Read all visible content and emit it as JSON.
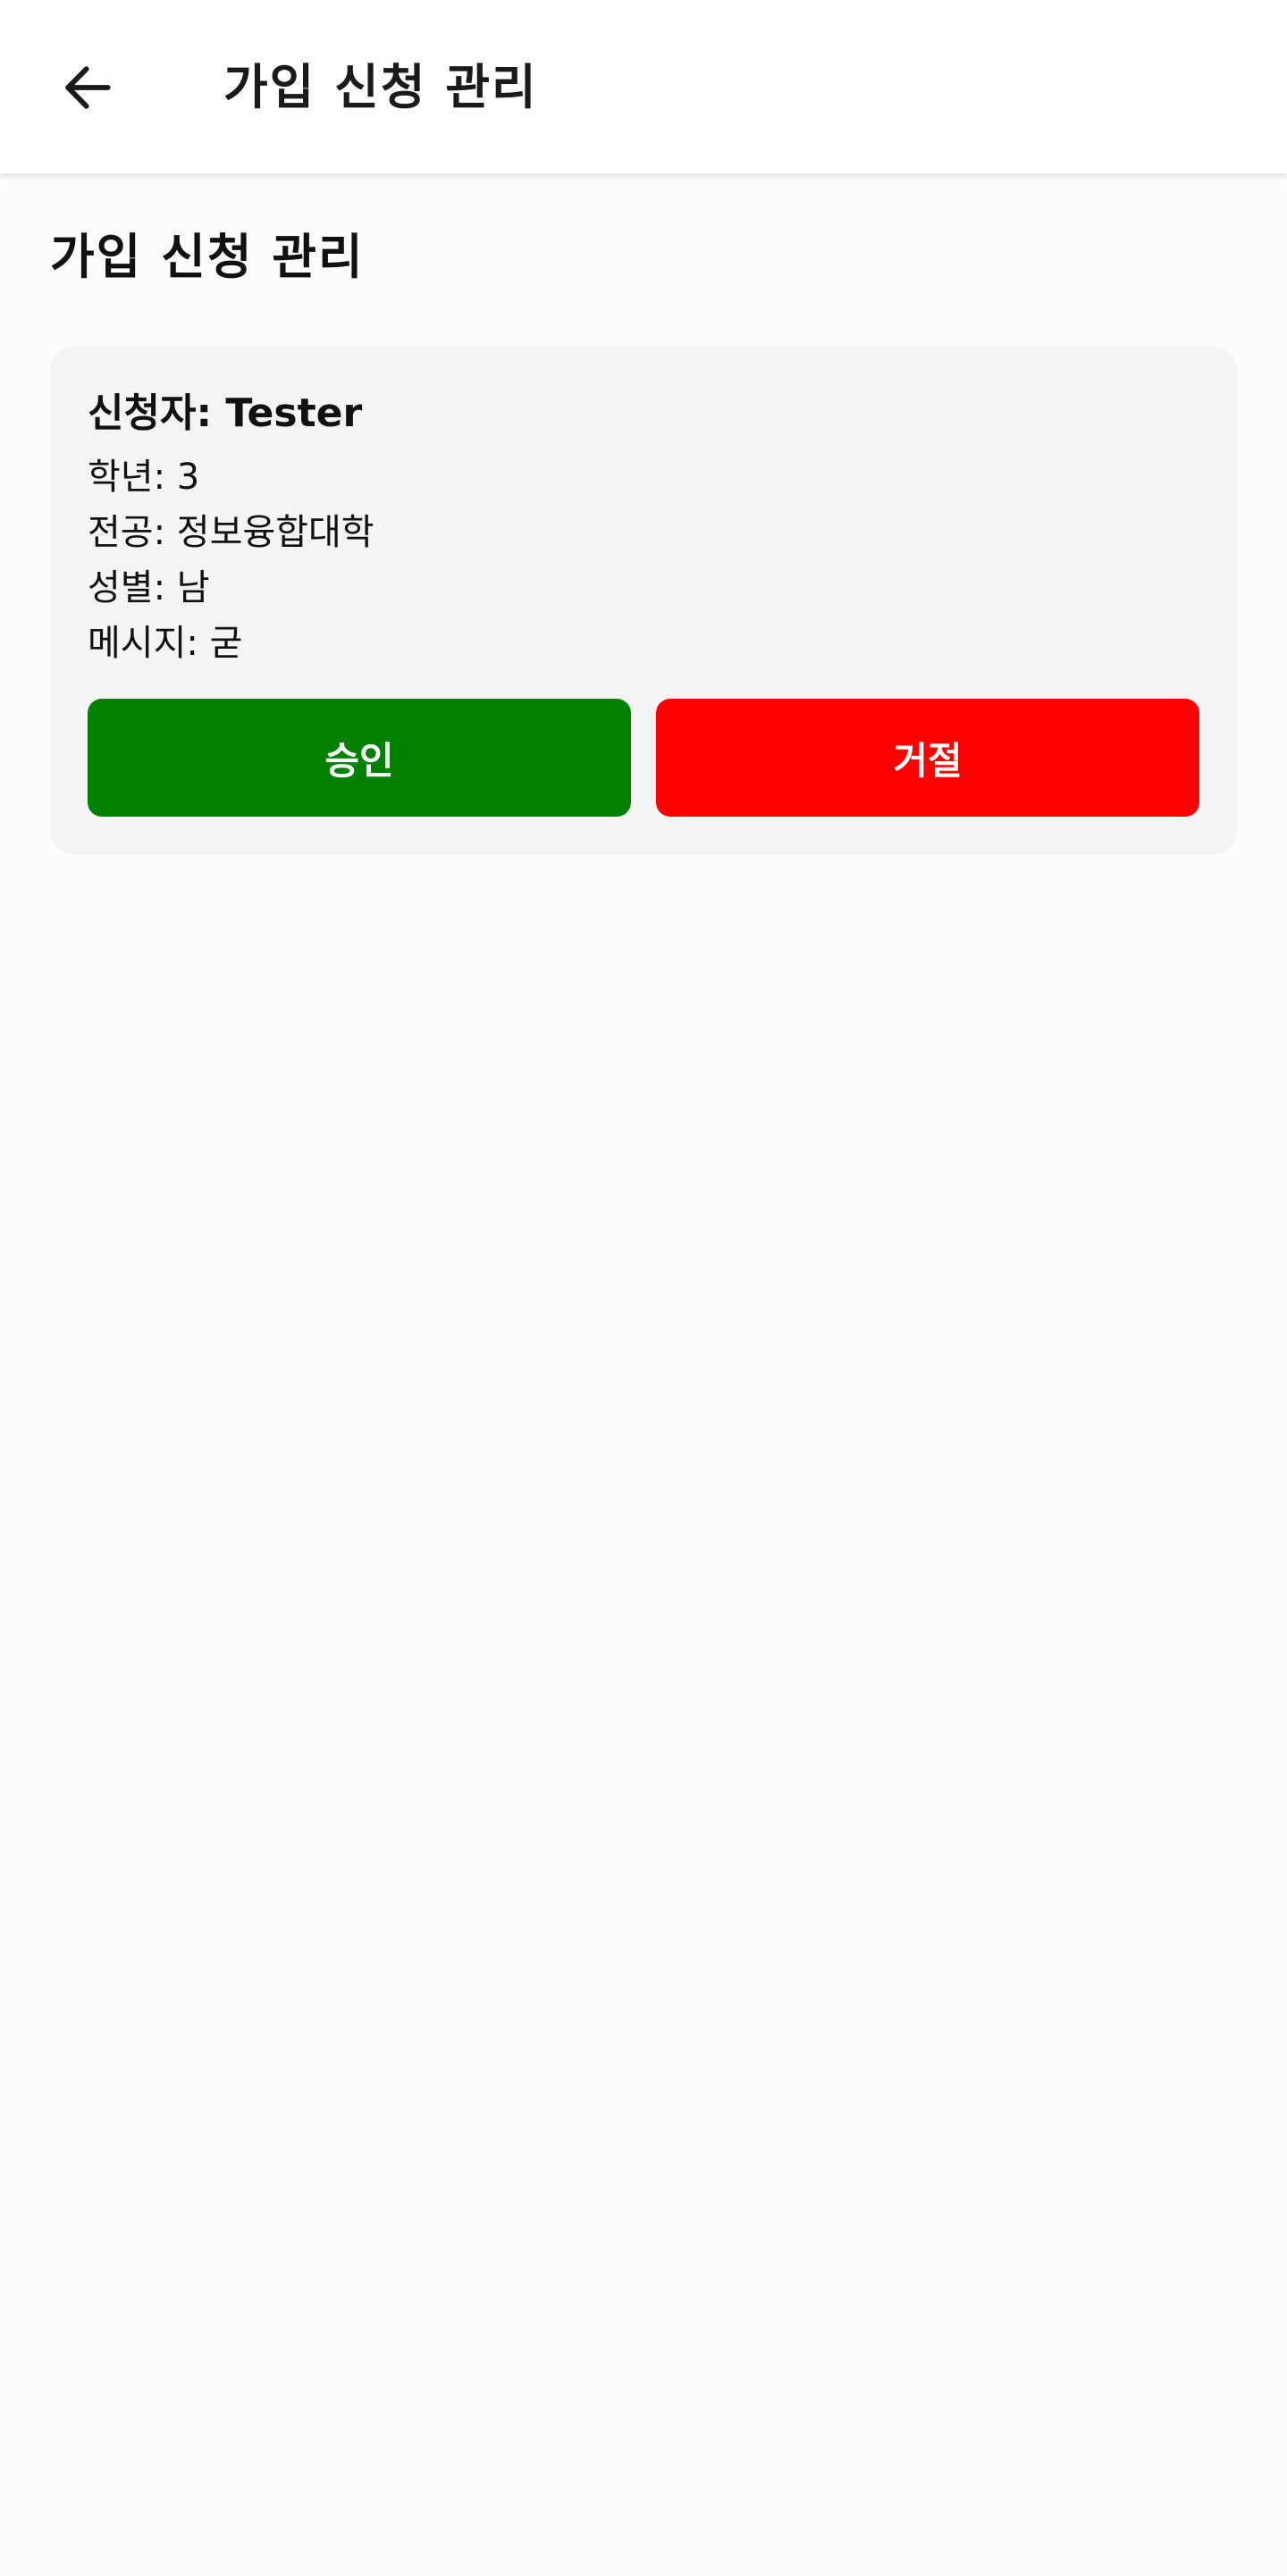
{
  "app_bar": {
    "back_icon": "arrow-back-icon",
    "title": "가입 신청 관리"
  },
  "page": {
    "title": "가입 신청 관리"
  },
  "request": {
    "applicant_label": "신청자:",
    "applicant_name": "Tester",
    "grade_label": "학년:",
    "grade_value": "3",
    "major_label": "전공:",
    "major_value": "정보융합대학",
    "gender_label": "성별:",
    "gender_value": "남",
    "message_label": "메시지:",
    "message_value": "굳",
    "approve_label": "승인",
    "reject_label": "거절"
  },
  "colors": {
    "approve": "#028000",
    "reject": "#ff0000",
    "card_background": "#f4f4f4",
    "page_background": "#fcfcfc"
  }
}
